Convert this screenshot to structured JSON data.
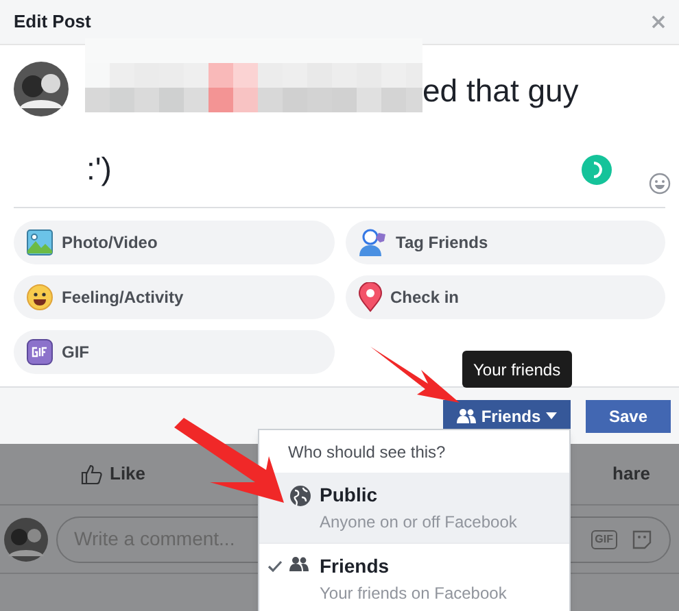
{
  "dialog": {
    "title": "Edit Post"
  },
  "post": {
    "lines": [
      "ed that guy",
      ":')"
    ]
  },
  "actions": [
    {
      "label": "Photo/Video"
    },
    {
      "kind": "tag",
      "label": "Tag Friends"
    },
    {
      "kind": "feeling",
      "label": "Feeling/Activity"
    },
    {
      "kind": "checkin",
      "label": "Check in"
    },
    {
      "kind": "gif",
      "label": "GIF"
    }
  ],
  "tooltip": "Your friends",
  "audience_button": {
    "label": "Friends"
  },
  "save_button": "Save",
  "feed": {
    "like": "Like",
    "share": "hare",
    "comment_placeholder": "Write a comment...",
    "gif_icon_text": "GIF"
  },
  "audience_menu": {
    "heading": "Who should see this?",
    "options": [
      {
        "kind": "public",
        "title": "Public",
        "subtitle": "Anyone on or off Facebook",
        "highlighted": true,
        "selected": false
      },
      {
        "kind": "friends",
        "title": "Friends",
        "subtitle": "Your friends on Facebook",
        "highlighted": false,
        "selected": true
      }
    ]
  }
}
